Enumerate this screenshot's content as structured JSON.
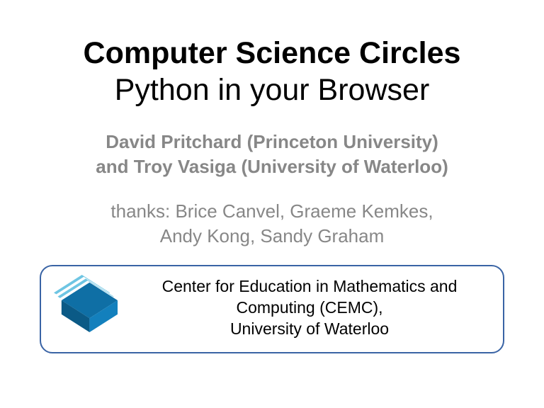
{
  "title": {
    "line1": "Computer Science Circles",
    "line2": "Python in your Browser"
  },
  "authors": {
    "line1": "David Pritchard (Princeton University)",
    "line2": "and Troy Vasiga (University of Waterloo)"
  },
  "thanks": {
    "line1": "thanks: Brice Canvel, Graeme Kemkes,",
    "line2": "Andy Kong, Sandy Graham"
  },
  "org": {
    "line1": "Center for Education in Mathematics and",
    "line2": "Computing (CEMC),",
    "line3": "University of Waterloo"
  },
  "colors": {
    "border": "#3a64a5",
    "logo_dark": "#0f6fa5",
    "logo_light": "#6ec5e3",
    "gray": "#878787"
  }
}
